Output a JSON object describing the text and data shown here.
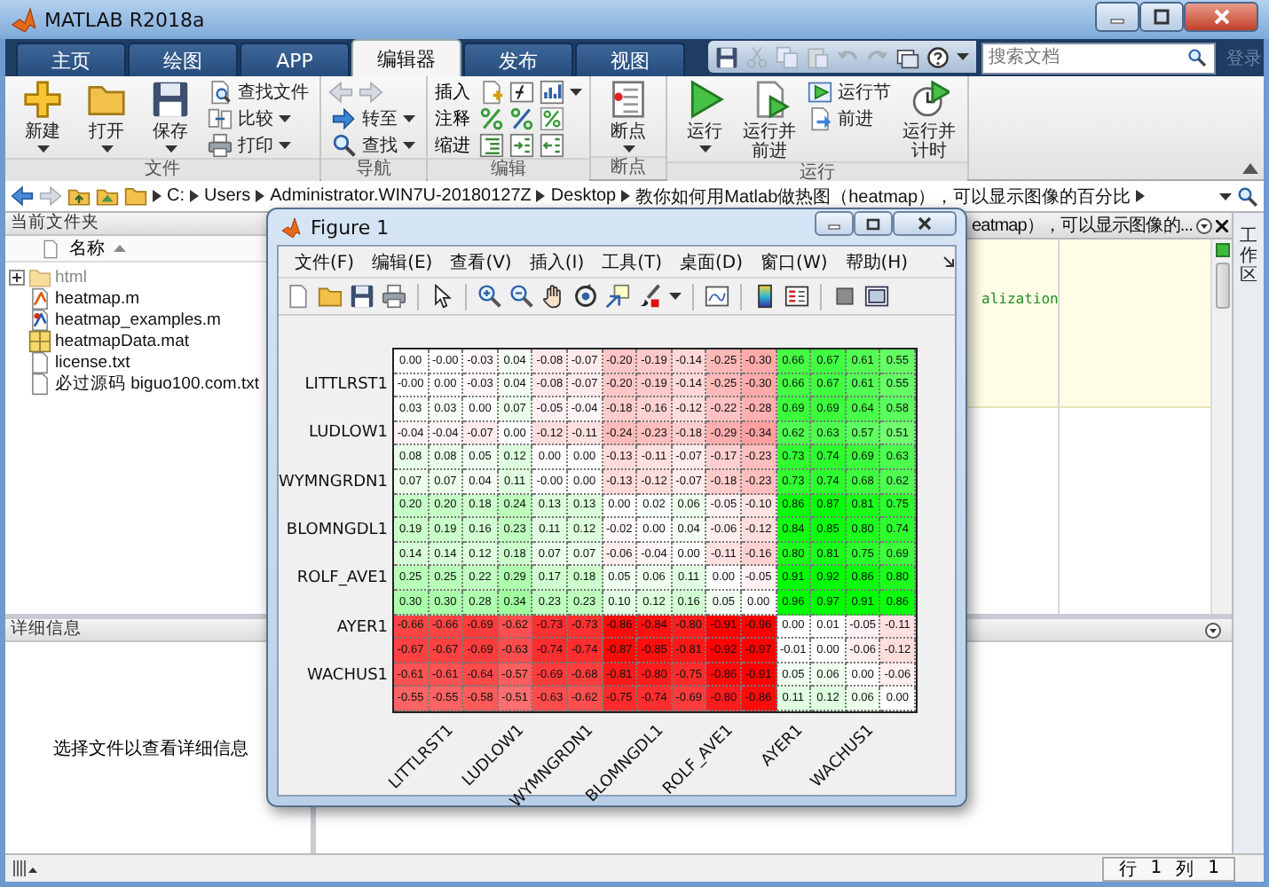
{
  "window": {
    "title": "MATLAB R2018a"
  },
  "ribbon": {
    "tabs": [
      {
        "label": "主页",
        "selected": false
      },
      {
        "label": "绘图",
        "selected": false
      },
      {
        "label": "APP",
        "selected": false
      },
      {
        "label": "编辑器",
        "selected": true
      },
      {
        "label": "发布",
        "selected": false
      },
      {
        "label": "视图",
        "selected": false
      }
    ],
    "search": {
      "placeholder": "搜索文档"
    },
    "login": {
      "label": "登录",
      "disabled": true
    },
    "groups": [
      {
        "title": "文件",
        "items": [
          {
            "kind": "large",
            "label": "新建",
            "menu": true
          },
          {
            "kind": "large",
            "label": "打开",
            "menu": true
          },
          {
            "kind": "large",
            "label": "保存",
            "menu": true
          },
          {
            "kind": "small",
            "label": "查找文件",
            "menu": false
          },
          {
            "kind": "small",
            "label": "比较",
            "menu": true
          },
          {
            "kind": "small",
            "label": "打印",
            "menu": true
          }
        ]
      },
      {
        "title": "导航",
        "items": [
          {
            "kind": "arrows",
            "disabled": true
          },
          {
            "kind": "small",
            "label": "转至",
            "menu": true
          },
          {
            "kind": "small",
            "label": "查找",
            "menu": true
          }
        ]
      },
      {
        "title": "编辑",
        "items": [
          {
            "kind": "tools",
            "label": "插入",
            "menu": true
          },
          {
            "kind": "tools",
            "label": "注释",
            "menu": false
          },
          {
            "kind": "tools",
            "label": "缩进",
            "menu": false
          }
        ]
      },
      {
        "title": "断点",
        "items": [
          {
            "kind": "large",
            "label": "断点",
            "menu": true
          }
        ]
      },
      {
        "title": "运行",
        "items": [
          {
            "kind": "large",
            "label": "运行",
            "menu": true
          },
          {
            "kind": "large",
            "label": "运行并前进",
            "menu": false
          },
          {
            "kind": "small",
            "label": "运行节",
            "menu": false
          },
          {
            "kind": "small",
            "label": "前进",
            "menu": false
          },
          {
            "kind": "large",
            "label": "运行并计时",
            "menu": false
          }
        ]
      }
    ]
  },
  "address": {
    "path": [
      "C:",
      "Users",
      "Administrator.WIN7U-20180127Z",
      "Desktop",
      "教你如何用Matlab做热图（heatmap），可以显示图像的百分比"
    ]
  },
  "files": {
    "title": "当前文件夹",
    "column": "名称",
    "items": [
      {
        "name": "html",
        "kind": "folder",
        "expanded": false,
        "greyed": true
      },
      {
        "name": "heatmap.m",
        "kind": "script",
        "greyed": false
      },
      {
        "name": "heatmap_examples.m",
        "kind": "script",
        "greyed": false
      },
      {
        "name": "heatmapData.mat",
        "kind": "data",
        "greyed": false
      },
      {
        "name": "license.txt",
        "kind": "text",
        "greyed": false
      },
      {
        "name": "必过源码 biguo100.com.txt",
        "kind": "text",
        "greyed": false
      }
    ]
  },
  "details": {
    "title": "详细信息",
    "message": "选择文件以查看详细信息"
  },
  "editor": {
    "tab": "eatmap），可以显示图像的...",
    "code": "alization"
  },
  "workspace": {
    "title": "工作区"
  },
  "status_bar": {
    "row_label": "行",
    "row": "1",
    "column_label": "列",
    "column": "1"
  },
  "figure": {
    "title": "Figure 1",
    "menu": [
      "文件(F)",
      "编辑(E)",
      "查看(V)",
      "插入(I)",
      "工具(T)",
      "桌面(D)",
      "窗口(W)",
      "帮助(H)"
    ],
    "heatmap": {
      "row_labels": [
        "LITTLRST1",
        "LUDLOW1",
        "WYMNGRDN1",
        "BLOMNGDL1",
        "ROLF_AVE1",
        "AYER1",
        "WACHUS1"
      ],
      "column_labels": [
        "LITTLRST1",
        "LUDLOW1",
        "WYMNGRDN1",
        "BLOMNGDL1",
        "ROLF_AVE1",
        "AYER1",
        "WACHUS1"
      ],
      "rows": [
        [
          "0.00",
          "-0.00",
          "-0.03",
          "0.04",
          "-0.08",
          "-0.07",
          "-0.20",
          "-0.19",
          "-0.14",
          "-0.25",
          "-0.30",
          "0.66",
          "0.67",
          "0.61",
          "0.55"
        ],
        [
          "-0.00",
          "0.00",
          "-0.03",
          "0.04",
          "-0.08",
          "-0.07",
          "-0.20",
          "-0.19",
          "-0.14",
          "-0.25",
          "-0.30",
          "0.66",
          "0.67",
          "0.61",
          "0.55"
        ],
        [
          "0.03",
          "0.03",
          "0.00",
          "0.07",
          "-0.05",
          "-0.04",
          "-0.18",
          "-0.16",
          "-0.12",
          "-0.22",
          "-0.28",
          "0.69",
          "0.69",
          "0.64",
          "0.58"
        ],
        [
          "-0.04",
          "-0.04",
          "-0.07",
          "0.00",
          "-0.12",
          "-0.11",
          "-0.24",
          "-0.23",
          "-0.18",
          "-0.29",
          "-0.34",
          "0.62",
          "0.63",
          "0.57",
          "0.51"
        ],
        [
          "0.08",
          "0.08",
          "0.05",
          "0.12",
          "0.00",
          "0.00",
          "-0.13",
          "-0.11",
          "-0.07",
          "-0.17",
          "-0.23",
          "0.73",
          "0.74",
          "0.69",
          "0.63"
        ],
        [
          "0.07",
          "0.07",
          "0.04",
          "0.11",
          "-0.00",
          "0.00",
          "-0.13",
          "-0.12",
          "-0.07",
          "-0.18",
          "-0.23",
          "0.73",
          "0.74",
          "0.68",
          "0.62"
        ],
        [
          "0.20",
          "0.20",
          "0.18",
          "0.24",
          "0.13",
          "0.13",
          "0.00",
          "0.02",
          "0.06",
          "-0.05",
          "-0.10",
          "0.86",
          "0.87",
          "0.81",
          "0.75"
        ],
        [
          "0.19",
          "0.19",
          "0.16",
          "0.23",
          "0.11",
          "0.12",
          "-0.02",
          "0.00",
          "0.04",
          "-0.06",
          "-0.12",
          "0.84",
          "0.85",
          "0.80",
          "0.74"
        ],
        [
          "0.14",
          "0.14",
          "0.12",
          "0.18",
          "0.07",
          "0.07",
          "-0.06",
          "-0.04",
          "0.00",
          "-0.11",
          "-0.16",
          "0.80",
          "0.81",
          "0.75",
          "0.69"
        ],
        [
          "0.25",
          "0.25",
          "0.22",
          "0.29",
          "0.17",
          "0.18",
          "0.05",
          "0.06",
          "0.11",
          "0.00",
          "-0.05",
          "0.91",
          "0.92",
          "0.86",
          "0.80"
        ],
        [
          "0.30",
          "0.30",
          "0.28",
          "0.34",
          "0.23",
          "0.23",
          "0.10",
          "0.12",
          "0.16",
          "0.05",
          "0.00",
          "0.96",
          "0.97",
          "0.91",
          "0.86"
        ],
        [
          "-0.66",
          "-0.66",
          "-0.69",
          "-0.62",
          "-0.73",
          "-0.73",
          "-0.86",
          "-0.84",
          "-0.80",
          "-0.91",
          "-0.96",
          "0.00",
          "0.01",
          "-0.05",
          "-0.11"
        ],
        [
          "-0.67",
          "-0.67",
          "-0.69",
          "-0.63",
          "-0.74",
          "-0.74",
          "-0.87",
          "-0.85",
          "-0.81",
          "-0.92",
          "-0.97",
          "-0.01",
          "0.00",
          "-0.06",
          "-0.12"
        ],
        [
          "-0.61",
          "-0.61",
          "-0.64",
          "-0.57",
          "-0.69",
          "-0.68",
          "-0.81",
          "-0.80",
          "-0.75",
          "-0.86",
          "-0.91",
          "0.05",
          "0.06",
          "0.00",
          "-0.06"
        ],
        [
          "-0.55",
          "-0.55",
          "-0.58",
          "-0.51",
          "-0.63",
          "-0.62",
          "-0.75",
          "-0.74",
          "-0.69",
          "-0.80",
          "-0.86",
          "0.11",
          "0.12",
          "0.06",
          "0.00"
        ]
      ]
    }
  }
}
